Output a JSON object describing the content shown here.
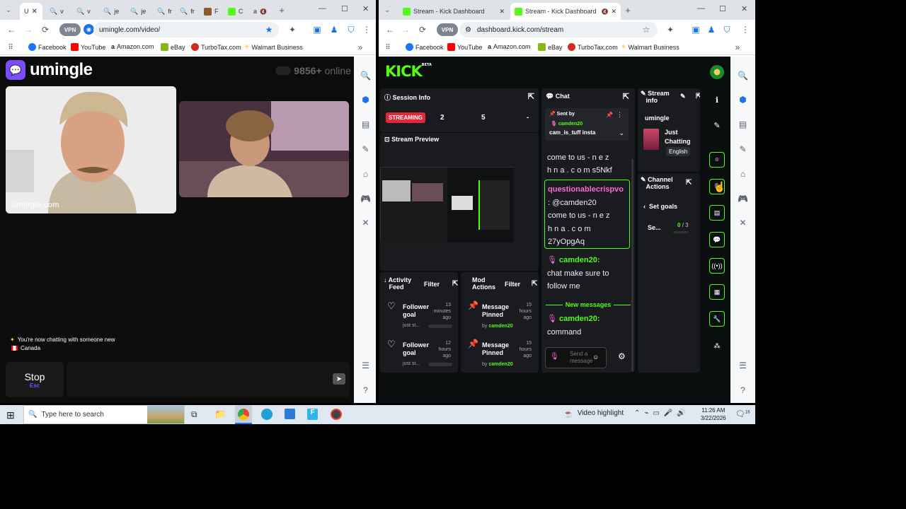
{
  "left_browser": {
    "tabs": [
      "U",
      "v",
      "v",
      "je",
      "je",
      "fr",
      "fr",
      "F",
      "C",
      "a"
    ],
    "url": "umingle.com/video/",
    "bookmarks": [
      "Facebook",
      "YouTube",
      "Amazon.com",
      "eBay",
      "TurboTax.com",
      "Walmart Business"
    ]
  },
  "right_browser": {
    "tabs": [
      "Stream - Kick Dashboard",
      "Stream - Kick Dashboard"
    ],
    "url": "dashboard.kick.com/stream",
    "bookmarks": [
      "Facebook",
      "YouTube",
      "Amazon.com",
      "eBay",
      "TurboTax.com",
      "Walmart Business"
    ]
  },
  "umingle": {
    "brand": "umingle",
    "online_count": "9856+",
    "online_label": "online",
    "watermark": "umingle.com",
    "status_text": "You're now chatting with someone new",
    "country": "Canada",
    "stop_label": "Stop",
    "stop_hint": "Esc"
  },
  "kick": {
    "logo": "KICK",
    "beta": "BETA",
    "session_info": {
      "title": "Session Info",
      "badge": "STREAMING",
      "stats": [
        "2",
        "5",
        "-"
      ]
    },
    "stream_preview": {
      "title": "Stream Preview"
    },
    "activity": {
      "title_1": "Activity",
      "title_2": "Feed",
      "filter": "Filter",
      "items": [
        {
          "t1": "Follower",
          "t2": "goal",
          "sub": "just st...",
          "time1": "13",
          "time2": "minutes",
          "time3": "ago"
        },
        {
          "t1": "Follower",
          "t2": "goal",
          "sub": "just st...",
          "time1": "12",
          "time2": "hours",
          "time3": "ago"
        }
      ]
    },
    "mod": {
      "title_1": "Mod",
      "title_2": "Actions",
      "filter": "Filter",
      "items": [
        {
          "t1": "Message",
          "t2": "Pinned",
          "by": "by",
          "user": "camden20",
          "time1": "15",
          "time2": "hours",
          "time3": "ago"
        },
        {
          "t1": "Message",
          "t2": "Pinned",
          "by": "by",
          "user": "camden20",
          "time1": "15",
          "time2": "hours",
          "time3": "ago"
        }
      ]
    },
    "chat": {
      "title": "Chat",
      "pinned_label": "Sent by",
      "pinned_user": "camden20",
      "pinned_msg": "cam_is_tuff insta",
      "msg1_lines": [
        "come to us - n e z",
        "h n a . c o m s5Nkf"
      ],
      "msg2_user": "questionablecrispvo",
      "msg2_lines": [
        ": @camden20",
        "come to us - n e z",
        "h n a . c o m",
        "27yOpgAq"
      ],
      "msg3_user": "camden20:",
      "msg3_lines": [
        "chat make sure to",
        "follow me"
      ],
      "divider": "New messages",
      "msg4_user": "camden20:",
      "msg4_line": "command",
      "input_placeholder": "Send a message"
    },
    "stream_info": {
      "title_1": "Stream",
      "title_2": "info",
      "channel": "umingle",
      "category_1": "Just",
      "category_2": "Chatting",
      "language": "English"
    },
    "channel_actions": {
      "title_1": "Channel",
      "title_2": "Actions",
      "set_goals": "Set goals",
      "item": "Se...",
      "progress_value": "0",
      "progress_total": "/ 3",
      "progress_fraction": 0
    }
  },
  "taskbar": {
    "search": "Type here to search",
    "highlight": "Video highlight",
    "time": "11:26 AM",
    "date": "3/22/2026",
    "notif": "16"
  },
  "colors": {
    "kick_green": "#53fc18",
    "streaming_red": "#e3273a",
    "umingle_purple": "#7b4dff"
  }
}
